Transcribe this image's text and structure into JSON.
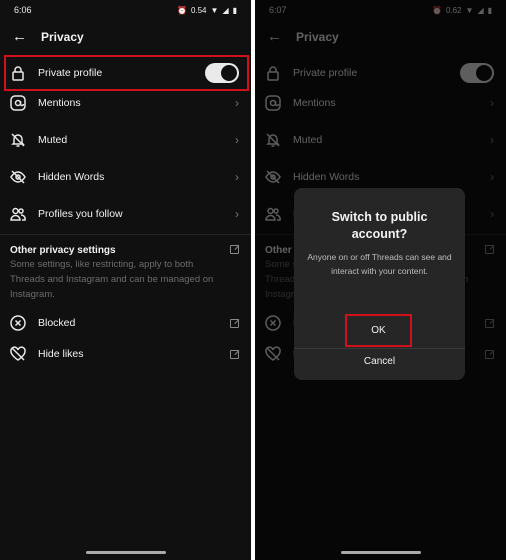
{
  "screens": [
    {
      "time": "6:06",
      "net_speed": "0.54"
    },
    {
      "time": "6:07",
      "net_speed": "0.62"
    }
  ],
  "header": {
    "title": "Privacy"
  },
  "items": [
    {
      "label": "Private profile",
      "icon": "lock-icon"
    },
    {
      "label": "Mentions",
      "icon": "at-icon"
    },
    {
      "label": "Muted",
      "icon": "bell-off-icon"
    },
    {
      "label": "Hidden Words",
      "icon": "eye-off-icon"
    },
    {
      "label": "Profiles you follow",
      "icon": "people-icon"
    }
  ],
  "private_profile_on": [
    true,
    true
  ],
  "other": {
    "title": "Other privacy settings",
    "description": "Some settings, like restricting, apply to both Threads and Instagram and can be managed on Instagram."
  },
  "other_items": [
    {
      "label": "Blocked",
      "icon": "x-circle-icon"
    },
    {
      "label": "Hide likes",
      "icon": "heart-off-icon"
    }
  ],
  "dialog": {
    "title": "Switch to public account?",
    "message": "Anyone on or off Threads can see and interact with your content.",
    "ok": "OK",
    "cancel": "Cancel"
  },
  "colors": {
    "highlight": "#d0101a",
    "background": "#101010"
  }
}
